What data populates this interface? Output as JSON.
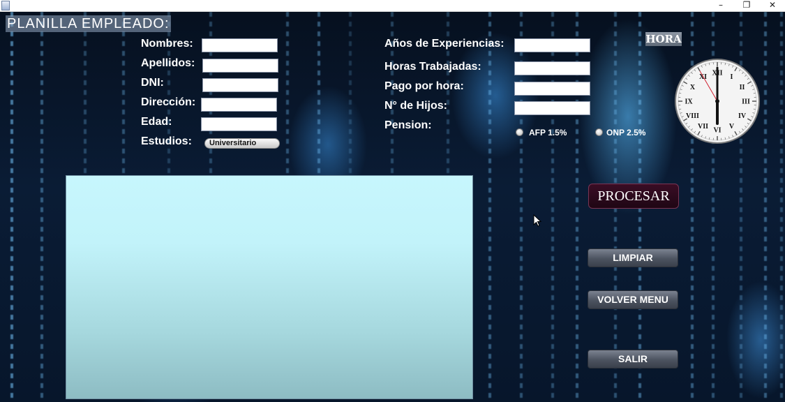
{
  "window": {
    "minimize_glyph": "–",
    "maximize_glyph": "❐",
    "close_glyph": "✕"
  },
  "form": {
    "title": "PLANILLA EMPLEADO:",
    "labels": {
      "nombres": "Nombres:",
      "apellidos": "Apellidos:",
      "dni": "DNI:",
      "direccion": "Dirección:",
      "edad": "Edad:",
      "estudios": "Estudios:",
      "anos_experiencia": "Años de Experiencias:",
      "horas_trabajadas": "Horas Trabajadas:",
      "pago_por_hora": "Pago por hora:",
      "n_hijos": "N° de Hijos:",
      "pension": "Pension:"
    },
    "values": {
      "nombres": "",
      "apellidos": "",
      "dni": "",
      "direccion": "",
      "edad": "",
      "anos_experiencia": "",
      "horas_trabajadas": "",
      "pago_por_hora": "",
      "n_hijos": ""
    },
    "estudios_selected": "Universitario",
    "pension_options": [
      "AFP 1.5%",
      "ONP 2.5%"
    ]
  },
  "clock": {
    "label": "HORA",
    "numerals": [
      "XII",
      "I",
      "II",
      "III",
      "IV",
      "V",
      "VI",
      "VII",
      "VIII",
      "IX",
      "X",
      "XI"
    ],
    "time": {
      "hours": 6,
      "minutes": 0,
      "seconds": 55
    }
  },
  "buttons": {
    "procesar": "PROCESAR",
    "limpiar": "LIMPIAR",
    "volver_menu": "VOLVER MENU",
    "salir": "SALIR"
  },
  "output": {
    "text": ""
  },
  "colors": {
    "background": "#0a1c35",
    "textarea": "#c7f6fd",
    "procesar": "#2a0a1c",
    "button": "#4c5360"
  }
}
